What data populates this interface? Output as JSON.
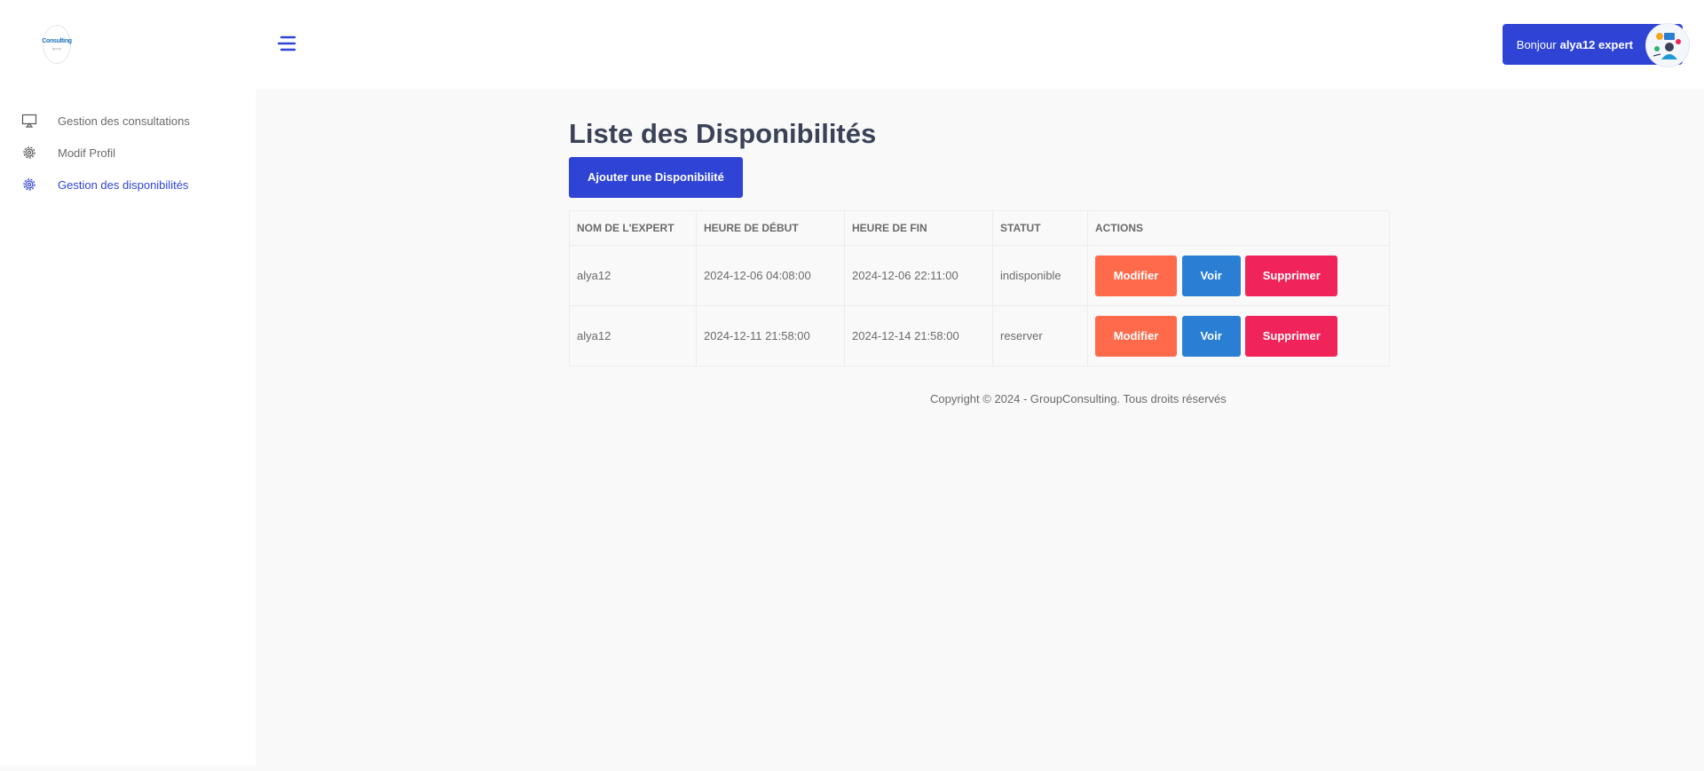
{
  "brand": {
    "logo_text": "Consulting",
    "logo_sub": "group"
  },
  "sidebar": {
    "items": [
      {
        "label": "Gestion des consultations",
        "icon": "monitor-icon",
        "active": false
      },
      {
        "label": "Modif Profil",
        "icon": "gear-icon",
        "active": false
      },
      {
        "label": "Gestion des disponibilités",
        "icon": "gear-icon",
        "active": true
      }
    ]
  },
  "topbar": {
    "greeting": "Bonjour",
    "username": "alya12 expert"
  },
  "main": {
    "title": "Liste des Disponibilités",
    "add_button": "Ajouter une Disponibilité",
    "table": {
      "headers": [
        "NOM DE L'EXPERT",
        "HEURE DE DÉBUT",
        "HEURE DE FIN",
        "STATUT",
        "ACTIONS"
      ],
      "rows": [
        {
          "expert": "alya12",
          "start": "2024-12-06 04:08:00",
          "end": "2024-12-06 22:11:00",
          "status": "indisponible"
        },
        {
          "expert": "alya12",
          "start": "2024-12-11 21:58:00",
          "end": "2024-12-14 21:58:00",
          "status": "reserver"
        }
      ],
      "actions": {
        "edit": "Modifier",
        "view": "Voir",
        "delete": "Supprimer"
      }
    }
  },
  "footer": {
    "text": "Copyright © 2024 - GroupConsulting. Tous droits réservés"
  },
  "colors": {
    "primary": "#2f44d5",
    "edit": "#ff6a4a",
    "view": "#2a7fd4",
    "delete": "#f0245a"
  }
}
